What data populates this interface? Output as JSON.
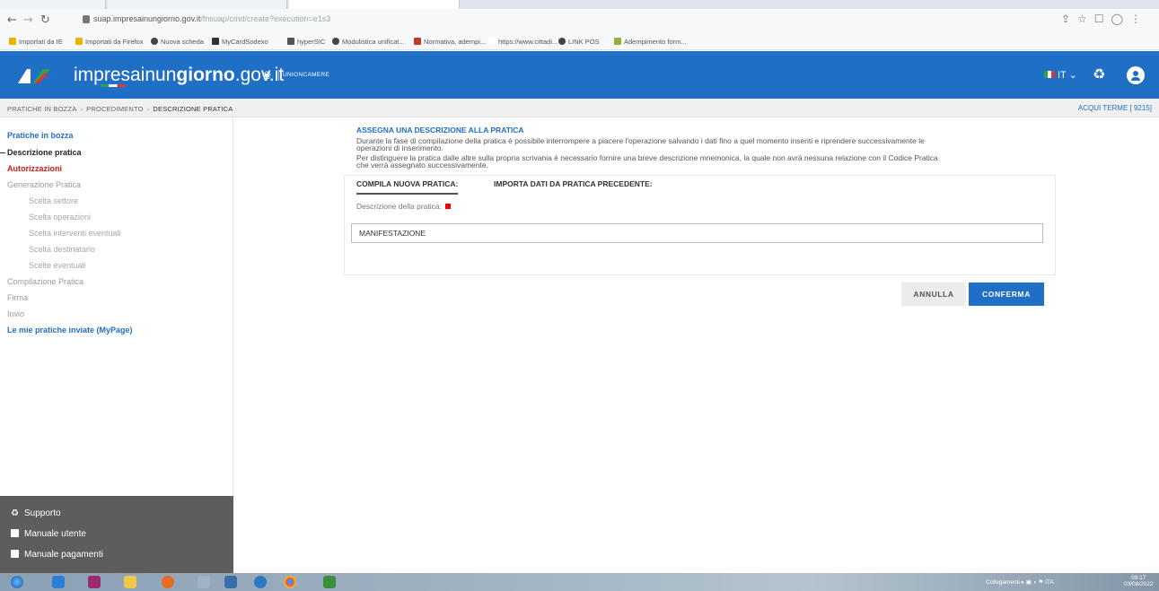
{
  "browser": {
    "tabs": [
      "",
      "",
      ""
    ],
    "url_host": "suap.impresainungiorno.gov.it",
    "url_path": "/fnsuap/cmd/create?execution=e1s3",
    "nav_icons": [
      "back-arrow",
      "forward-arrow",
      "reload"
    ],
    "right_icons": [
      "share-icon",
      "star-icon",
      "sidebar-icon",
      "profile-icon",
      "menu-icon"
    ],
    "bookmarks": [
      {
        "label": "Importati da IE",
        "icon": "folder",
        "color": "#e8b400"
      },
      {
        "label": "Importati da Firefox",
        "icon": "folder",
        "color": "#e8b400"
      },
      {
        "label": "Nuova scheda",
        "icon": "globe",
        "color": "#444444"
      },
      {
        "label": "MyCardSodexo",
        "icon": "star",
        "color": "#333333"
      },
      {
        "label": "hyperSIC",
        "icon": "logo",
        "color": "#555555"
      },
      {
        "label": "Modulistica unificat...",
        "icon": "globe",
        "color": "#444444"
      },
      {
        "label": "Normativa, adempi...",
        "icon": "logo",
        "color": "#c0392b"
      },
      {
        "label": "https://www.cittadi...",
        "icon": "none",
        "color": "#ffffff"
      },
      {
        "label": "LINK POS",
        "icon": "globe",
        "color": "#444444"
      },
      {
        "label": "Adempimento form...",
        "icon": "logo",
        "color": "#8bb23a"
      }
    ]
  },
  "header": {
    "brand_light": "impresainun",
    "brand_bold": "giorno",
    "brand_suffix": ".gov.it",
    "partner": "UNIONCAMERE",
    "language": "IT",
    "brand_color": "#1f6fc6"
  },
  "breadcrumb": {
    "items": [
      "PRATICHE IN BOZZA",
      "PROCEDIMENTO",
      "DESCRIZIONE PRATICA"
    ],
    "office": "ACQUI TERME [ 9215]"
  },
  "sidebar": {
    "items": [
      {
        "label": "Pratiche in bozza",
        "state": "link"
      },
      {
        "label": "Descrizione pratica",
        "state": "current"
      },
      {
        "label": "Autorizzazioni",
        "state": "alert"
      },
      {
        "label": "Generazione Pratica",
        "state": "muted"
      },
      {
        "label": "Scelta settore",
        "state": "sub"
      },
      {
        "label": "Scelta operazioni",
        "state": "sub"
      },
      {
        "label": "Scelta interventi eventuali",
        "state": "sub"
      },
      {
        "label": "Scelta destinatario",
        "state": "sub"
      },
      {
        "label": "Scelte eventuali",
        "state": "sub"
      },
      {
        "label": "Compilazione Pratica",
        "state": "muted"
      },
      {
        "label": "Firma",
        "state": "muted"
      },
      {
        "label": "Invio",
        "state": "muted"
      },
      {
        "label": "Le mie pratiche inviate (MyPage)",
        "state": "link"
      }
    ],
    "bottom": [
      {
        "label": "Supporto",
        "icon": "support-icon"
      },
      {
        "label": "Manuale utente",
        "icon": "document-icon"
      },
      {
        "label": "Manuale pagamenti",
        "icon": "document-icon"
      }
    ]
  },
  "main": {
    "title": "ASSEGNA UNA DESCRIZIONE ALLA PRATICA",
    "paragraph_lines": [
      "Durante la fase di compilazione della pratica è possibile interrompere a piacere l'operazione salvando i dati fino a quel momento inseriti e riprendere successivamente le",
      "operazioni di inserimento.",
      "Per distinguere la pratica dalle altre sulla propria scrivania è necessario fornire una breve descrizione mnemonica, la quale non avrà nessuna relazione con il Codice Pratica",
      "che verrà assegnato successivamente."
    ],
    "tabs": [
      "COMPILA NUOVA PRATICA:",
      "IMPORTA DATI DA PRATICA PRECEDENTE:"
    ],
    "field_label": "Descrizione della pratica:",
    "field_value": "MANIFESTAZIONE",
    "cancel_label": "ANNULLA",
    "confirm_label": "CONFERMA"
  },
  "taskbar": {
    "tray_text": "Collegamenti",
    "language": "ITA",
    "time": "09:17",
    "date": "03/08/2022"
  }
}
